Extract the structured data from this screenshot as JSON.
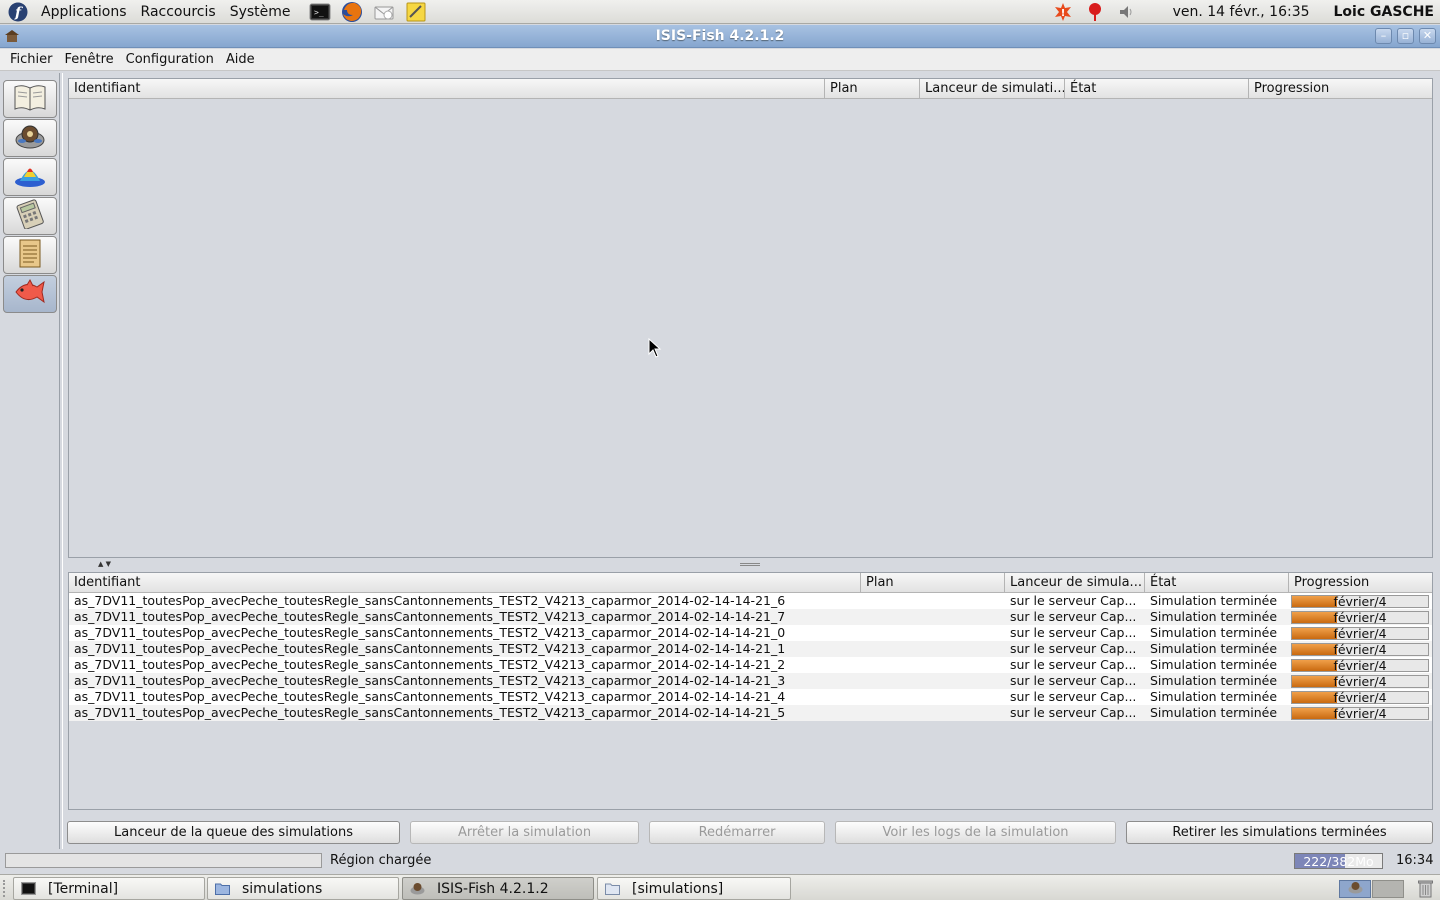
{
  "top_panel": {
    "menus": [
      "Applications",
      "Raccourcis",
      "Système"
    ],
    "launchers": [
      "terminal-icon",
      "firefox-icon",
      "mail-icon",
      "notes-icon"
    ],
    "tray_icons": [
      "update-alert-icon",
      "network-alert-icon",
      "volume-icon"
    ],
    "clock": "ven. 14 févr., 16:35",
    "user": "Loic GASCHE"
  },
  "window": {
    "title": "ISIS-Fish 4.2.1.2",
    "controls": [
      "minimize",
      "maximize",
      "close"
    ]
  },
  "menubar": [
    "Fichier",
    "Fenêtre",
    "Configuration",
    "Aide"
  ],
  "toolbar": {
    "items": [
      {
        "name": "book-icon",
        "active": false
      },
      {
        "name": "fish-simulator-icon",
        "active": false
      },
      {
        "name": "3d-plot-icon",
        "active": false
      },
      {
        "name": "calculator-icon",
        "active": false
      },
      {
        "name": "notepad-icon",
        "active": false
      },
      {
        "name": "fish-queue-icon",
        "active": true
      }
    ]
  },
  "queue_table": {
    "columns": [
      "Identifiant",
      "Plan",
      "Lanceur de simulati...",
      "État",
      "Progression"
    ],
    "rows": []
  },
  "done_table": {
    "columns": [
      "Identifiant",
      "Plan",
      "Lanceur de simula...",
      "État",
      "Progression"
    ],
    "rows": [
      {
        "id": "as_7DV11_toutesPop_avecPeche_toutesRegle_sansCantonnements_TEST2_V4213_caparmor_2014-02-14-14-21_6",
        "plan": "",
        "launcher": "sur le serveur Cap...",
        "state": "Simulation terminée",
        "progress_text": "février/4",
        "progress": 0.33
      },
      {
        "id": "as_7DV11_toutesPop_avecPeche_toutesRegle_sansCantonnements_TEST2_V4213_caparmor_2014-02-14-14-21_7",
        "plan": "",
        "launcher": "sur le serveur Cap...",
        "state": "Simulation terminée",
        "progress_text": "février/4",
        "progress": 0.33
      },
      {
        "id": "as_7DV11_toutesPop_avecPeche_toutesRegle_sansCantonnements_TEST2_V4213_caparmor_2014-02-14-14-21_0",
        "plan": "",
        "launcher": "sur le serveur Cap...",
        "state": "Simulation terminée",
        "progress_text": "février/4",
        "progress": 0.33
      },
      {
        "id": "as_7DV11_toutesPop_avecPeche_toutesRegle_sansCantonnements_TEST2_V4213_caparmor_2014-02-14-14-21_1",
        "plan": "",
        "launcher": "sur le serveur Cap...",
        "state": "Simulation terminée",
        "progress_text": "février/4",
        "progress": 0.33
      },
      {
        "id": "as_7DV11_toutesPop_avecPeche_toutesRegle_sansCantonnements_TEST2_V4213_caparmor_2014-02-14-14-21_2",
        "plan": "",
        "launcher": "sur le serveur Cap...",
        "state": "Simulation terminée",
        "progress_text": "février/4",
        "progress": 0.33
      },
      {
        "id": "as_7DV11_toutesPop_avecPeche_toutesRegle_sansCantonnements_TEST2_V4213_caparmor_2014-02-14-14-21_3",
        "plan": "",
        "launcher": "sur le serveur Cap...",
        "state": "Simulation terminée",
        "progress_text": "février/4",
        "progress": 0.33
      },
      {
        "id": "as_7DV11_toutesPop_avecPeche_toutesRegle_sansCantonnements_TEST2_V4213_caparmor_2014-02-14-14-21_4",
        "plan": "",
        "launcher": "sur le serveur Cap...",
        "state": "Simulation terminée",
        "progress_text": "février/4",
        "progress": 0.33
      },
      {
        "id": "as_7DV11_toutesPop_avecPeche_toutesRegle_sansCantonnements_TEST2_V4213_caparmor_2014-02-14-14-21_5",
        "plan": "",
        "launcher": "sur le serveur Cap...",
        "state": "Simulation terminée",
        "progress_text": "février/4",
        "progress": 0.33
      }
    ]
  },
  "buttons": {
    "launch_queue": "Lanceur de la queue des simulations",
    "stop": "Arrêter la simulation",
    "restart": "Redémarrer",
    "view_logs": "Voir les logs de la simulation",
    "remove_finished": "Retirer les simulations terminées"
  },
  "status": {
    "text": "Région chargée",
    "memory": "222/382Mo",
    "memory_used_fraction": 0.58,
    "time": "16:34"
  },
  "taskbar": {
    "tasks": [
      {
        "label": "[Terminal]",
        "icon": "terminal-icon",
        "active": false
      },
      {
        "label": "simulations",
        "icon": "folder-icon",
        "active": false
      },
      {
        "label": "ISIS-Fish 4.2.1.2",
        "icon": "isis-fish-icon",
        "active": true
      },
      {
        "label": "[simulations]",
        "icon": "folder-icon",
        "active": false
      }
    ]
  }
}
